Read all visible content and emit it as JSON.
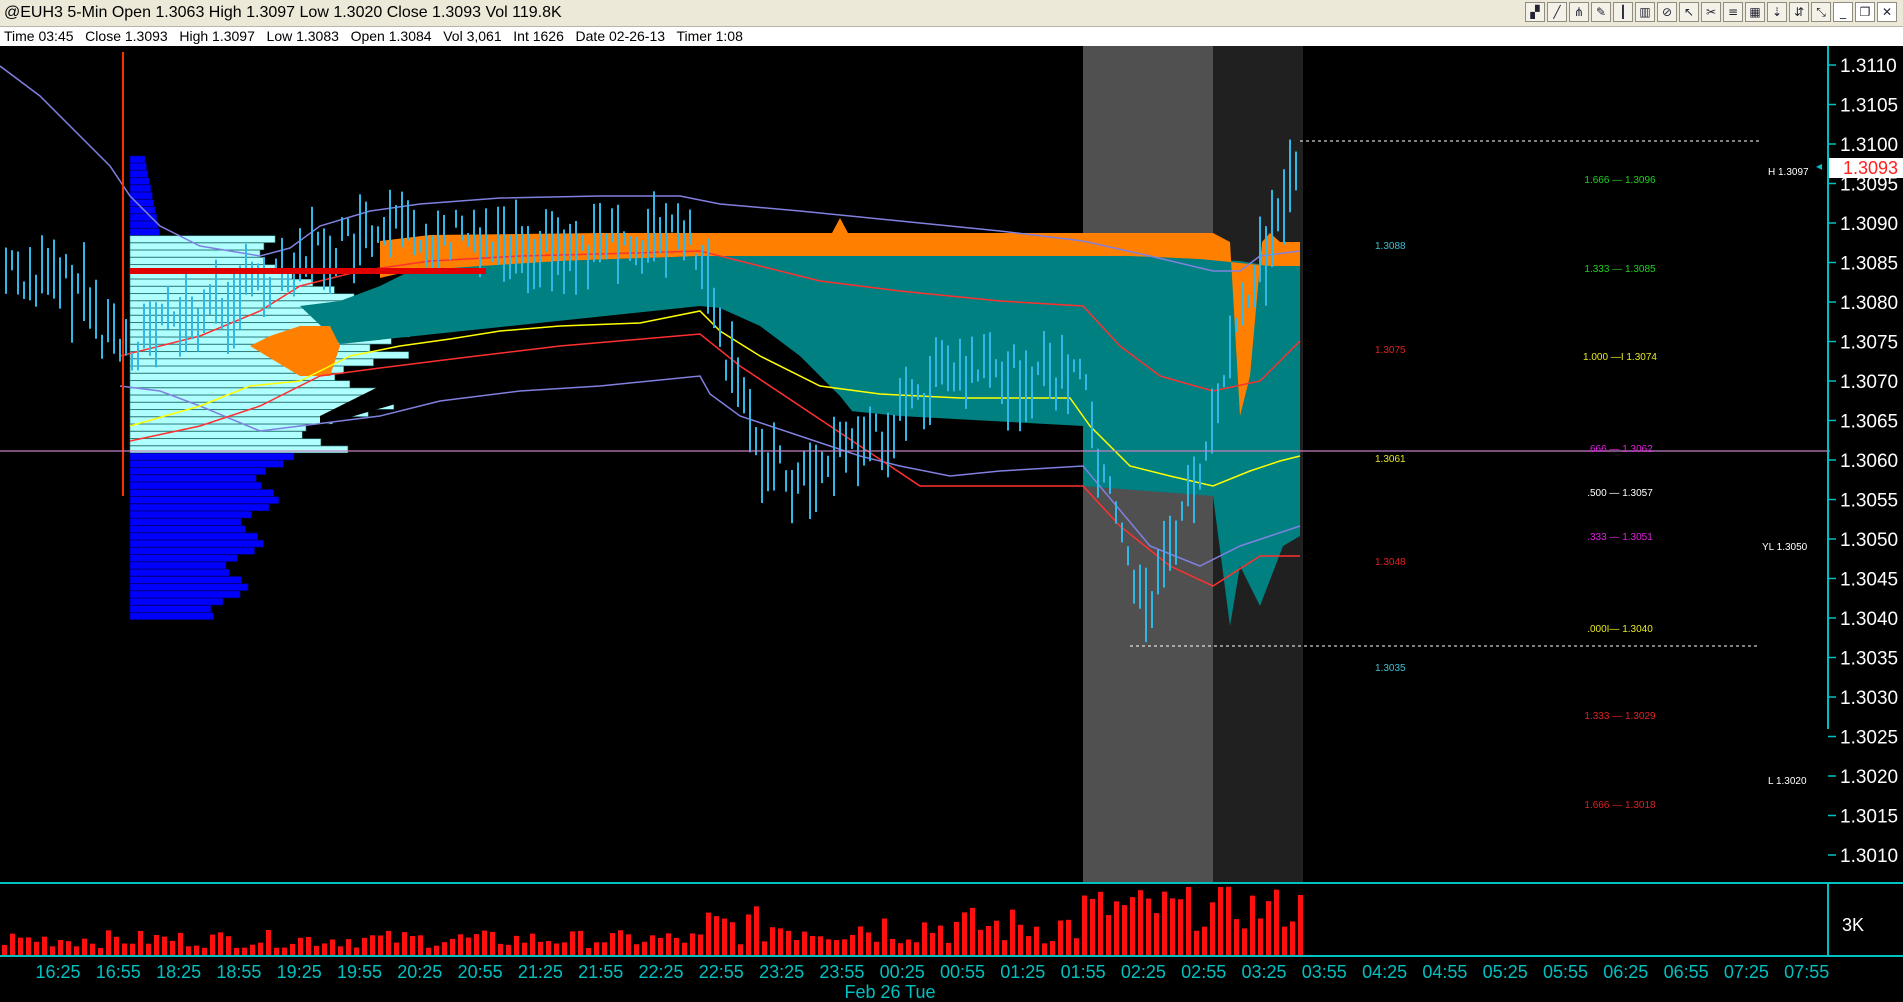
{
  "window": {
    "title": "@EUH3 5-Min Open 1.3063 High 1.3097 Low 1.3020 Close 1.3093 Vol 119.8K"
  },
  "toolbar": {
    "buttons": [
      {
        "name": "data-tool-icon"
      },
      {
        "name": "trendline-tool-icon"
      },
      {
        "name": "pitchfork-tool-icon"
      },
      {
        "name": "pencil-tool-icon"
      },
      {
        "name": "bar-tool-icon"
      },
      {
        "name": "chart-type-icon"
      },
      {
        "name": "stop-icon"
      },
      {
        "name": "cursor-icon"
      },
      {
        "name": "scissors-icon"
      },
      {
        "name": "fibonacci-icon"
      },
      {
        "name": "options-icon"
      },
      {
        "name": "pin-icon"
      },
      {
        "name": "arrows-icon"
      },
      {
        "name": "link-icon"
      }
    ],
    "window_buttons": [
      {
        "name": "minimize-icon",
        "glyph": "_"
      },
      {
        "name": "restore-icon",
        "glyph": "❐"
      },
      {
        "name": "close-icon",
        "glyph": "✕"
      }
    ]
  },
  "info_bar": {
    "text": "Time 03:45   Close 1.3093   High 1.3097   Low 1.3083   Open 1.3084   Vol 3,061   Int 1626   Date 02-26-13   Timer 1:08"
  },
  "price_axis": {
    "ticks": [
      "1.3110",
      "1.3105",
      "1.3100",
      "1.3095",
      "1.3090",
      "1.3085",
      "1.3080",
      "1.3075",
      "1.3070",
      "1.3065",
      "1.3060",
      "1.3055",
      "1.3050",
      "1.3045",
      "1.3040",
      "1.3035",
      "1.3030",
      "1.3025",
      "1.3020",
      "1.3015",
      "1.3010"
    ],
    "last_price": "1.3093",
    "last_price_color": "#ff2020"
  },
  "volume_axis": {
    "label": "3K"
  },
  "time_axis": {
    "ticks": [
      "16:25",
      "16:55",
      "18:25",
      "18:55",
      "19:25",
      "19:55",
      "20:25",
      "20:55",
      "21:25",
      "21:55",
      "22:25",
      "22:55",
      "23:25",
      "23:55",
      "00:25",
      "00:55",
      "01:25",
      "01:55",
      "02:25",
      "02:55",
      "03:25",
      "03:55",
      "04:25",
      "04:55",
      "05:25",
      "05:55",
      "06:25",
      "06:55",
      "07:25",
      "07:55"
    ],
    "date_label": "Feb 26 Tue"
  },
  "annotations": {
    "high_label": "H  1.3097",
    "low_label": "L  1.3020",
    "yesterday_low_label": "YL  1.3050",
    "pivot_levels": [
      {
        "text": "1.3088",
        "color": "#40c0d0"
      },
      {
        "text": "1.3075",
        "color": "#e02020"
      },
      {
        "text": "1.3061",
        "color": "#e8e820"
      },
      {
        "text": "1.3048",
        "color": "#e02020"
      },
      {
        "text": "1.3035",
        "color": "#40c0d0"
      }
    ],
    "fib_levels": [
      {
        "text": "1.666 — 1.3096",
        "color": "#20d020"
      },
      {
        "text": "1.333 — 1.3085",
        "color": "#20d020"
      },
      {
        "text": "1.000 —I 1.3074",
        "color": "#e8e820"
      },
      {
        "text": ".666 — 1.3062",
        "color": "#e020e0"
      },
      {
        "text": ".500 — 1.3057",
        "color": "#ffffff"
      },
      {
        "text": ".333 — 1.3051",
        "color": "#e020e0"
      },
      {
        "text": ".000I— 1.3040",
        "color": "#e8e820"
      },
      {
        "text": "1.333 — 1.3029",
        "color": "#e02020"
      },
      {
        "text": "1.666 — 1.3018",
        "color": "#e02020"
      }
    ]
  },
  "colors": {
    "price_bars": "#30b8e8",
    "cloud": "#008080",
    "cloud_band": "#ff8000",
    "profile_upper": "#b0ffff",
    "profile_lower": "#0000ff",
    "poc": "#e00000",
    "volume": "#ff1010",
    "axis": "#00c0c0",
    "yl_line": "#c080c0"
  }
}
